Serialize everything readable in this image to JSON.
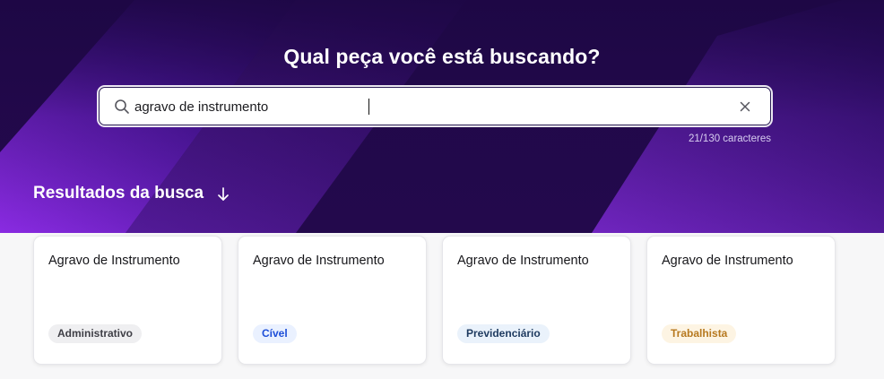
{
  "hero": {
    "title": "Qual peça você está buscando?",
    "colors": {
      "background": "#24094f",
      "accent": "#7c2fe0"
    }
  },
  "search": {
    "value": "agravo de instrumento",
    "char_count": "21/130 caracteres",
    "icon": "search-icon",
    "clear_icon": "close-icon"
  },
  "results": {
    "heading": "Resultados da busca",
    "heading_icon": "arrow-down-icon",
    "cards": [
      {
        "title": "Agravo de Instrumento",
        "badge": "Administrativo",
        "badge_color": "#3f3f46",
        "badge_bg": "#efeff1"
      },
      {
        "title": "Agravo de Instrumento",
        "badge": "Cível",
        "badge_color": "#1d4ed8",
        "badge_bg": "#eaf1ff"
      },
      {
        "title": "Agravo de Instrumento",
        "badge": "Previdenciário",
        "badge_color": "#1e3a5f",
        "badge_bg": "#eaf2fb"
      },
      {
        "title": "Agravo de Instrumento",
        "badge": "Trabalhista",
        "badge_color": "#b7791f",
        "badge_bg": "#fdf4e3"
      }
    ]
  }
}
